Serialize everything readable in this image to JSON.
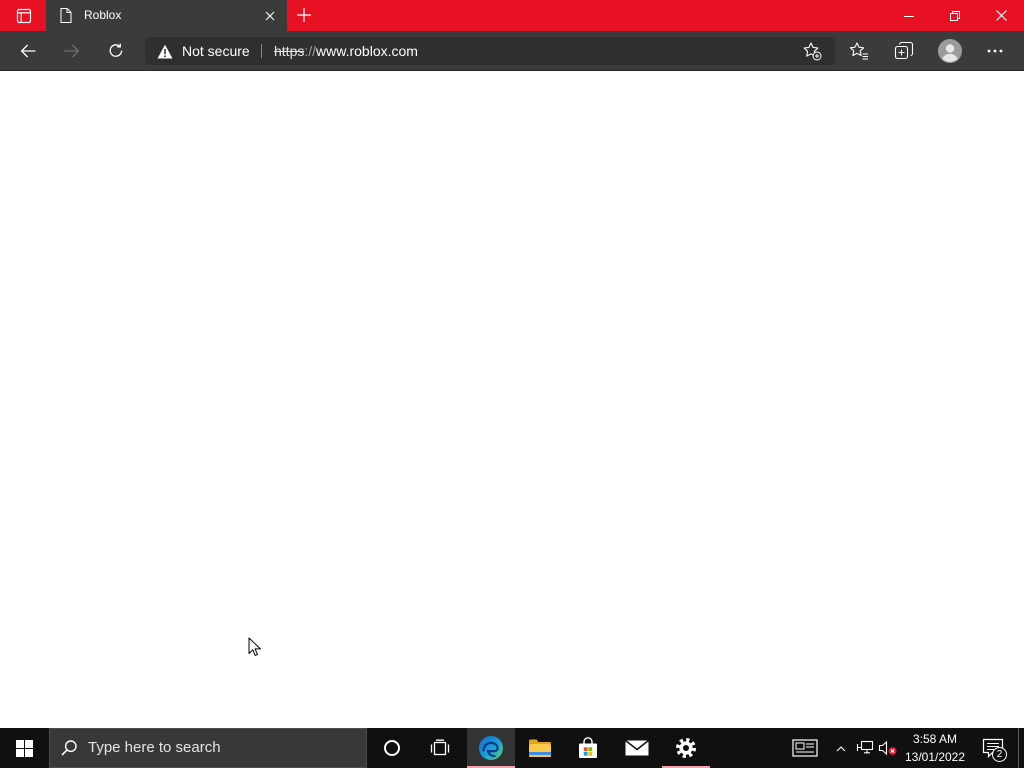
{
  "browser": {
    "tab_strip": {
      "tab_actions_icon": "tab-actions-icon",
      "tabs": [
        {
          "title": "Roblox",
          "icon": "page-icon",
          "close_icon": "close-icon",
          "active": true
        }
      ],
      "new_tab_icon": "plus-icon"
    },
    "window_controls": {
      "minimize_icon": "minimize-icon",
      "restore_icon": "restore-icon",
      "close_icon": "close-icon"
    },
    "toolbar": {
      "back_icon": "back-arrow-icon",
      "forward_icon": "forward-arrow-icon",
      "forward_enabled": false,
      "refresh_icon": "refresh-icon",
      "address_bar": {
        "security_icon": "warning-icon",
        "security_label": "Not secure",
        "url": {
          "scheme": "https",
          "separator": "://",
          "host": "www.roblox.com"
        },
        "scheme_struck_through": true,
        "add_favorite_icon": "star-plus-icon"
      },
      "favorites_icon": "favorites-icon",
      "collections_icon": "collections-icon",
      "profile_icon": "profile-avatar-icon",
      "more_icon": "more-dots-icon"
    },
    "page": {
      "blank": true
    }
  },
  "cursor": {
    "icon": "mouse-pointer-icon"
  },
  "taskbar": {
    "start_icon": "windows-logo-icon",
    "search": {
      "icon": "search-icon",
      "placeholder": "Type here to search"
    },
    "apps": [
      {
        "icon": "cortana-icon",
        "running": false
      },
      {
        "icon": "task-view-icon",
        "running": false
      },
      {
        "icon": "edge-icon",
        "running": true,
        "active": true
      },
      {
        "icon": "file-explorer-icon",
        "running": false
      },
      {
        "icon": "store-icon",
        "running": false
      },
      {
        "icon": "mail-icon",
        "running": false
      },
      {
        "icon": "settings-gear-icon",
        "running": true,
        "active": false
      }
    ],
    "tray": {
      "icons": [
        "news-icon",
        "chevron-up-icon",
        "network-icon",
        "volume-muted-icon"
      ]
    },
    "clock": {
      "time": "3:58 AM",
      "date": "13/01/2022"
    },
    "notifications": {
      "icon": "notification-center-icon",
      "count": "2"
    }
  },
  "colors": {
    "accent": "#e81123",
    "chrome": "#3b3b3b",
    "omnibox": "#2f2f2f",
    "taskbar": "#101010",
    "indicator": "#f0a5ad",
    "page_background": "#ffffff"
  }
}
